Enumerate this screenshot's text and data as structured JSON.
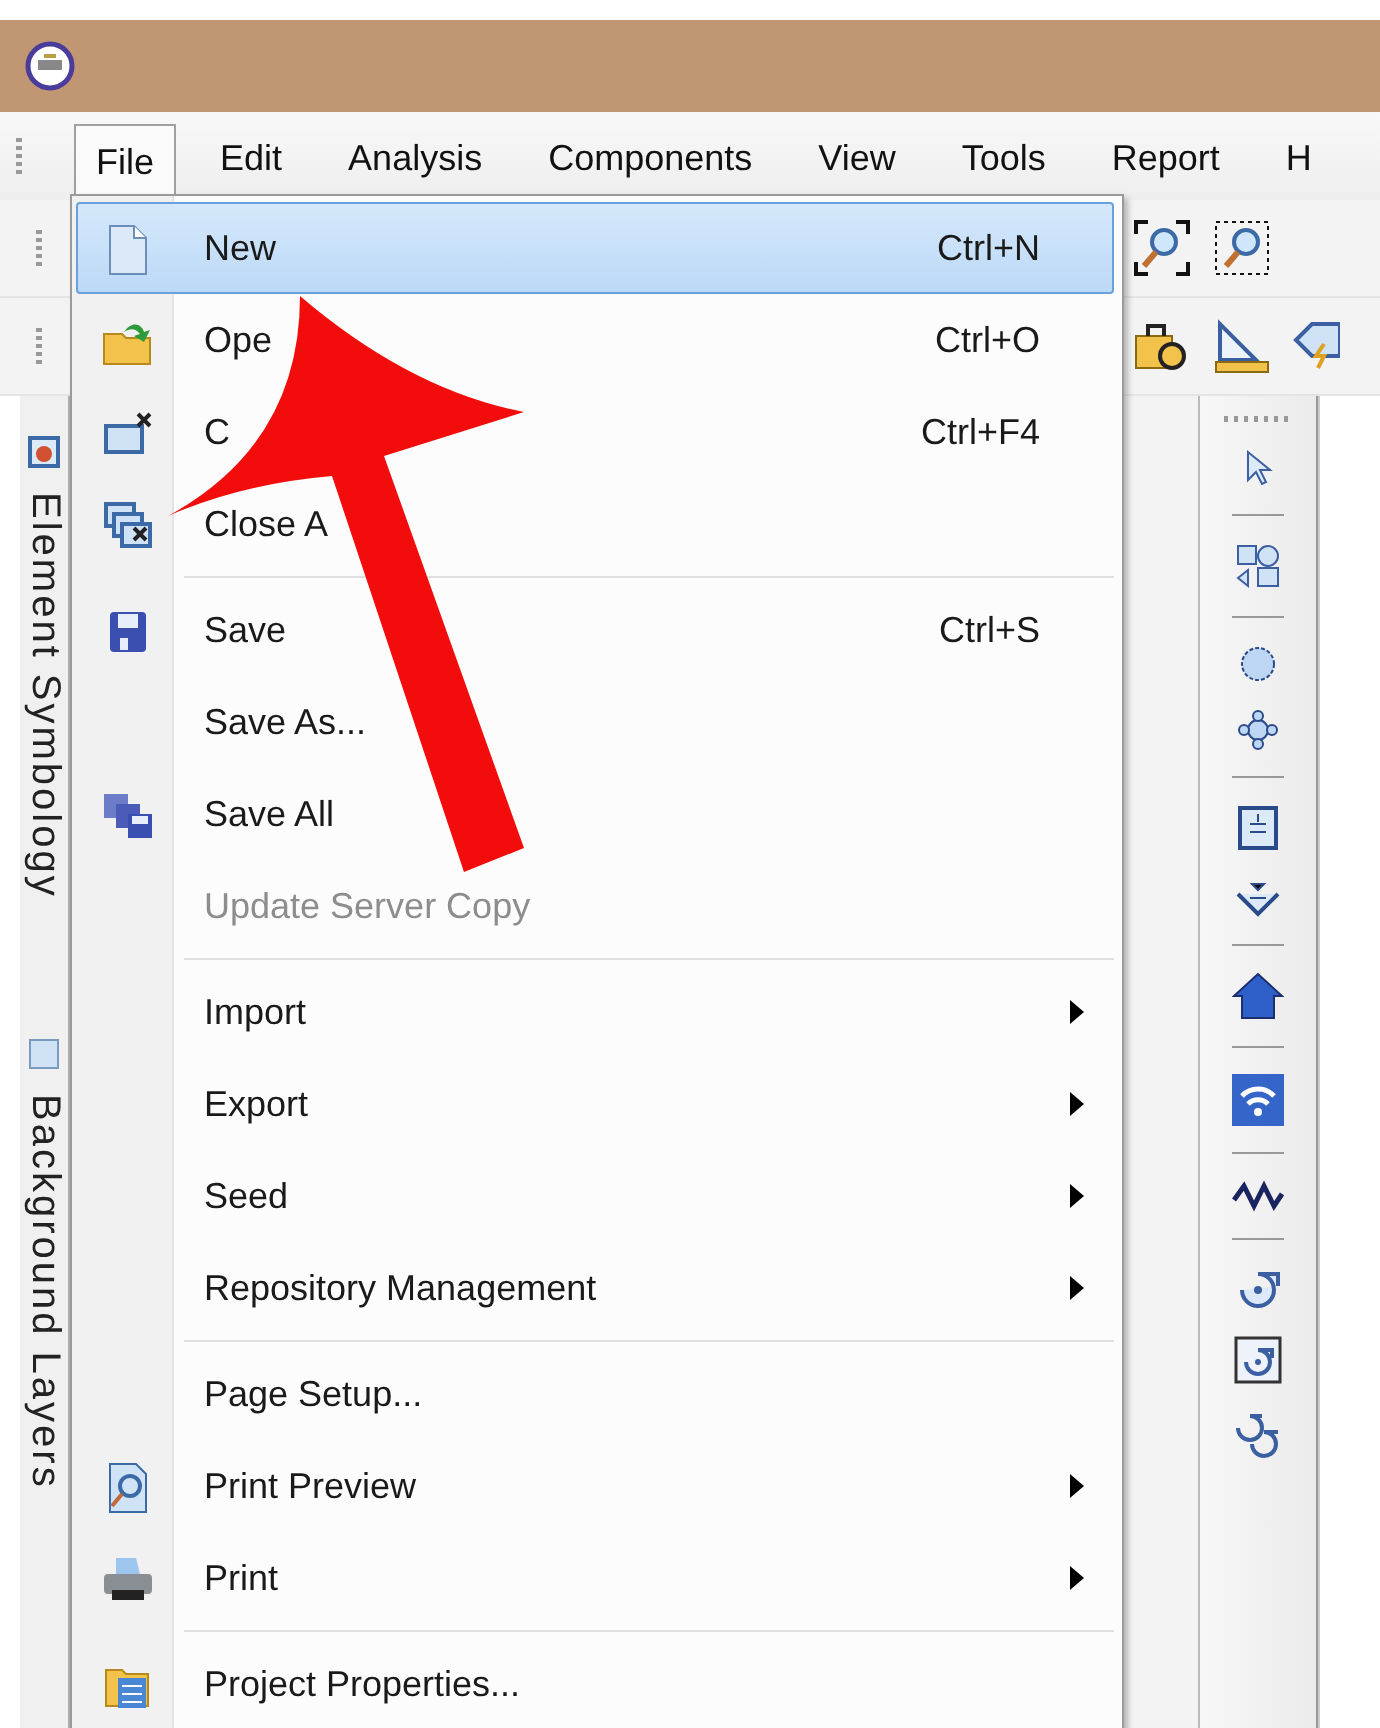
{
  "menu_bar": [
    {
      "label": "File",
      "selected": true
    },
    {
      "label": "Edit",
      "selected": false
    },
    {
      "label": "Analysis",
      "selected": false
    },
    {
      "label": "Components",
      "selected": false
    },
    {
      "label": "View",
      "selected": false
    },
    {
      "label": "Tools",
      "selected": false
    },
    {
      "label": "Report",
      "selected": false
    },
    {
      "label": "H",
      "selected": false
    }
  ],
  "side_tabs": [
    {
      "label": "Element Symbology"
    },
    {
      "label": "Background Layers"
    }
  ],
  "file_menu": {
    "groups": [
      [
        {
          "label": "New",
          "shortcut": "Ctrl+N",
          "selected": true,
          "disabled": false,
          "submenu": false
        },
        {
          "label": "Ope",
          "shortcut": "Ctrl+O",
          "selected": false,
          "disabled": false,
          "submenu": false
        },
        {
          "label": "C",
          "shortcut": "Ctrl+F4",
          "selected": false,
          "disabled": false,
          "submenu": false
        },
        {
          "label": "Close A",
          "selected": false,
          "disabled": false,
          "submenu": false
        }
      ],
      [
        {
          "label": "Save",
          "shortcut": "Ctrl+S",
          "selected": false,
          "disabled": false,
          "submenu": false
        },
        {
          "label": "Save As...",
          "selected": false,
          "disabled": false,
          "submenu": false
        },
        {
          "label": "Save All",
          "selected": false,
          "disabled": false,
          "submenu": false
        },
        {
          "label": "Update Server Copy",
          "selected": false,
          "disabled": true,
          "submenu": false
        }
      ],
      [
        {
          "label": "Import",
          "selected": false,
          "disabled": false,
          "submenu": true
        },
        {
          "label": "Export",
          "selected": false,
          "disabled": false,
          "submenu": true
        },
        {
          "label": "Seed",
          "selected": false,
          "disabled": false,
          "submenu": true
        },
        {
          "label": "Repository Management",
          "selected": false,
          "disabled": false,
          "submenu": true
        }
      ],
      [
        {
          "label": "Page Setup...",
          "selected": false,
          "disabled": false,
          "submenu": false
        },
        {
          "label": "Print Preview",
          "selected": false,
          "disabled": false,
          "submenu": true
        },
        {
          "label": "Print",
          "selected": false,
          "disabled": false,
          "submenu": true
        }
      ],
      [
        {
          "label": "Project Properties...",
          "selected": false,
          "disabled": false,
          "submenu": false
        }
      ]
    ]
  }
}
